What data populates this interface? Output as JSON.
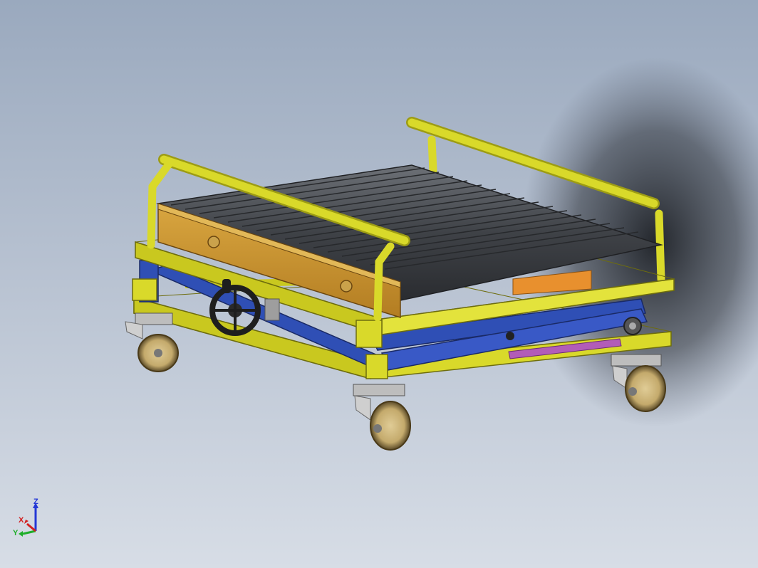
{
  "viewport": {
    "background_top": "#9aa9be",
    "background_bottom": "#d7dde6"
  },
  "model": {
    "name_icon": "scissor-lift-roller-cart",
    "colors": {
      "frame": "#d9d92a",
      "frame_dark": "#9d9c14",
      "scissor": "#2f4fb5",
      "roller": "#4a4d52",
      "side_plate": "#c9962f",
      "wheel": "#c8b27a",
      "handwheel": "#1e1e1e",
      "accent_bar": "#b25cb8"
    }
  },
  "triad": {
    "x_label": "X",
    "y_label": "Y",
    "z_label": "Z",
    "x_color": "#d22020",
    "y_color": "#1fae2a",
    "z_color": "#2438d6"
  }
}
